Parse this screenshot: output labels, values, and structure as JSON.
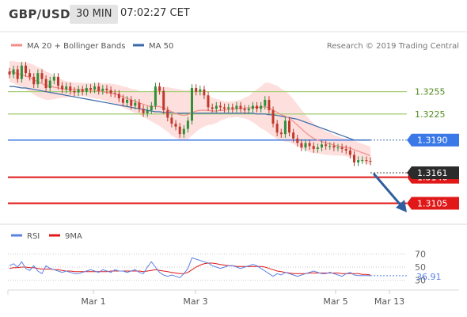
{
  "header": {
    "pair": "GBP/USD",
    "timeframe": "30 MIN",
    "time": "07:02:27 CET"
  },
  "legend": {
    "ma20_bb": "MA 20 + Bollinger Bands",
    "ma50": "MA 50",
    "credit": "Research © 2019 Trading Central"
  },
  "sub_legend": {
    "rsi": "RSI",
    "ma9": "9MA"
  },
  "colors": {
    "bull": "#2f8f3a",
    "bear": "#c0392b",
    "ma20": "#f28e8a",
    "bb_fill": "#fde0de",
    "ma50": "#3a6aa8",
    "resistance": "#a9cf7d",
    "pivot": "#3b78e7",
    "support": "#e01818",
    "rsi": "#5b80e6",
    "rsi_ma": "#e01818",
    "arrow": "#2f5f9e"
  },
  "chart_data": [
    {
      "type": "candlestick",
      "ylim": [
        1.308,
        1.331
      ],
      "current_price": "1.3161",
      "levels": [
        {
          "label": "1.3255",
          "value": 1.3255,
          "kind": "resistance"
        },
        {
          "label": "1.3225",
          "value": 1.3225,
          "kind": "resistance"
        },
        {
          "label": "1.3190",
          "value": 1.319,
          "kind": "pivot"
        },
        {
          "label": "1.3140",
          "value": 1.314,
          "kind": "support"
        },
        {
          "label": "1.3105",
          "value": 1.3105,
          "kind": "support"
        }
      ],
      "x_ticks": [
        "Mar 1",
        "Mar 3",
        "Mar 5",
        "Mar 13"
      ],
      "closes": [
        1.3278,
        1.3285,
        1.3272,
        1.329,
        1.328,
        1.3275,
        1.3265,
        1.328,
        1.3272,
        1.326,
        1.327,
        1.3275,
        1.3263,
        1.3258,
        1.3262,
        1.3256,
        1.3254,
        1.3258,
        1.3255,
        1.326,
        1.3258,
        1.3262,
        1.3256,
        1.3259,
        1.3257,
        1.3253,
        1.3252,
        1.3246,
        1.324,
        1.3244,
        1.3236,
        1.324,
        1.3232,
        1.3226,
        1.323,
        1.3236,
        1.3262,
        1.3256,
        1.323,
        1.322,
        1.3212,
        1.3208,
        1.3198,
        1.3205,
        1.3216,
        1.326,
        1.3255,
        1.3258,
        1.325,
        1.3234,
        1.3232,
        1.3236,
        1.3234,
        1.3232,
        1.3234,
        1.3232,
        1.3236,
        1.3232,
        1.323,
        1.3232,
        1.3236,
        1.3232,
        1.3236,
        1.3244,
        1.323,
        1.3212,
        1.32,
        1.3198,
        1.3216,
        1.32,
        1.3192,
        1.3186,
        1.318,
        1.3186,
        1.3182,
        1.3178,
        1.318,
        1.3184,
        1.3182,
        1.3182,
        1.318,
        1.318,
        1.3178,
        1.3176,
        1.317,
        1.316,
        1.3163,
        1.3163,
        1.3162,
        1.3161
      ],
      "ma20": [
        1.3282,
        1.3281,
        1.3279,
        1.3278,
        1.3276,
        1.3274,
        1.3271,
        1.3268,
        1.3266,
        1.3263,
        1.3262,
        1.3261,
        1.326,
        1.3259,
        1.3258,
        1.3258,
        1.3258,
        1.3258,
        1.3258,
        1.3257,
        1.3257,
        1.3256,
        1.3256,
        1.3255,
        1.3254,
        1.3253,
        1.3252,
        1.325,
        1.3248,
        1.3246,
        1.3244,
        1.3242,
        1.324,
        1.3238,
        1.3236,
        1.3235,
        1.3235,
        1.3235,
        1.3233,
        1.3231,
        1.3228,
        1.3226,
        1.3224,
        1.3223,
        1.3224,
        1.3227,
        1.3229,
        1.323,
        1.323,
        1.323,
        1.3229,
        1.3229,
        1.323,
        1.323,
        1.3231,
        1.3231,
        1.3232,
        1.3232,
        1.3233,
        1.3233,
        1.3234,
        1.3234,
        1.3234,
        1.3235,
        1.3233,
        1.323,
        1.3227,
        1.3224,
        1.3222,
        1.3219,
        1.3215,
        1.321,
        1.3205,
        1.32,
        1.3196,
        1.3192,
        1.319,
        1.3188,
        1.3186,
        1.3185,
        1.3183,
        1.3182,
        1.3181,
        1.318,
        1.3179,
        1.3177,
        1.3175,
        1.3173,
        1.3171,
        1.3169
      ],
      "bb_width": [
        0.0014,
        0.0015,
        0.0016,
        0.0017,
        0.0018,
        0.0019,
        0.002,
        0.002,
        0.002,
        0.0019,
        0.0018,
        0.0016,
        0.0014,
        0.0012,
        0.0011,
        0.001,
        0.0009,
        0.0009,
        0.0009,
        0.0009,
        0.001,
        0.001,
        0.0011,
        0.0011,
        0.0012,
        0.0013,
        0.0013,
        0.0014,
        0.0014,
        0.0015,
        0.0015,
        0.0016,
        0.0016,
        0.0017,
        0.0018,
        0.002,
        0.0023,
        0.0026,
        0.0028,
        0.003,
        0.0032,
        0.0033,
        0.0034,
        0.0034,
        0.0033,
        0.0031,
        0.0028,
        0.0025,
        0.0022,
        0.002,
        0.0018,
        0.0016,
        0.0014,
        0.0012,
        0.0011,
        0.0011,
        0.0011,
        0.0012,
        0.0014,
        0.0016,
        0.002,
        0.0024,
        0.0028,
        0.0032,
        0.0034,
        0.0035,
        0.0036,
        0.0035,
        0.0034,
        0.0032,
        0.003,
        0.0028,
        0.0026,
        0.0024,
        0.0022,
        0.002,
        0.0018,
        0.0017,
        0.0016,
        0.0015,
        0.0014,
        0.0013,
        0.0012,
        0.0012,
        0.0012,
        0.0012,
        0.0012,
        0.0012,
        0.0012,
        0.0012
      ],
      "ma50": [
        1.3262,
        1.3262,
        1.3261,
        1.326,
        1.326,
        1.3259,
        1.3258,
        1.3257,
        1.3256,
        1.3255,
        1.3254,
        1.3253,
        1.3252,
        1.3251,
        1.325,
        1.3249,
        1.3248,
        1.3247,
        1.3246,
        1.3245,
        1.3244,
        1.3243,
        1.3242,
        1.3241,
        1.324,
        1.3239,
        1.3238,
        1.3237,
        1.3236,
        1.3235,
        1.3234,
        1.3233,
        1.3232,
        1.3231,
        1.323,
        1.3229,
        1.3228,
        1.3228,
        1.3227,
        1.3227,
        1.3227,
        1.3226,
        1.3226,
        1.3226,
        1.3226,
        1.3226,
        1.3226,
        1.3226,
        1.3226,
        1.3226,
        1.3226,
        1.3226,
        1.3226,
        1.3226,
        1.3226,
        1.3226,
        1.3226,
        1.3226,
        1.3226,
        1.3226,
        1.3226,
        1.3225,
        1.3225,
        1.3225,
        1.3224,
        1.3224,
        1.3223,
        1.3222,
        1.3221,
        1.322,
        1.3219,
        1.3218,
        1.3216,
        1.3214,
        1.3212,
        1.321,
        1.3208,
        1.3206,
        1.3204,
        1.3202,
        1.32,
        1.3198,
        1.3196,
        1.3194,
        1.3192,
        1.319,
        1.319,
        1.319,
        1.319,
        1.319
      ]
    },
    {
      "type": "line",
      "ylim": [
        20,
        80
      ],
      "y_ticks": [
        "70",
        "50",
        "30"
      ],
      "current_value": "36.91",
      "rsi": [
        52,
        55,
        50,
        58,
        48,
        45,
        52,
        44,
        40,
        52,
        48,
        46,
        44,
        42,
        44,
        42,
        40,
        40,
        42,
        44,
        46,
        44,
        42,
        46,
        44,
        42,
        46,
        44,
        44,
        42,
        44,
        46,
        42,
        40,
        50,
        58,
        50,
        42,
        38,
        36,
        38,
        36,
        34,
        40,
        48,
        64,
        62,
        60,
        58,
        56,
        52,
        50,
        48,
        50,
        52,
        52,
        50,
        48,
        50,
        52,
        54,
        52,
        48,
        44,
        40,
        36,
        40,
        38,
        42,
        40,
        38,
        36,
        38,
        40,
        42,
        44,
        42,
        40,
        40,
        42,
        40,
        38,
        36,
        40,
        42,
        38,
        37,
        37,
        37,
        36.91
      ],
      "ma9": [
        48,
        49,
        49,
        50,
        50,
        49,
        49,
        48,
        47,
        47,
        47,
        46,
        46,
        45,
        44,
        44,
        43,
        43,
        43,
        43,
        43,
        43,
        43,
        43,
        43,
        44,
        44,
        44,
        44,
        44,
        44,
        44,
        44,
        43,
        44,
        45,
        46,
        45,
        44,
        43,
        42,
        41,
        40,
        40,
        42,
        46,
        50,
        53,
        55,
        56,
        56,
        55,
        54,
        53,
        52,
        52,
        51,
        51,
        51,
        51,
        51,
        51,
        51,
        50,
        48,
        46,
        44,
        43,
        42,
        41,
        40,
        40,
        40,
        40,
        41,
        41,
        41,
        41,
        41,
        41,
        41,
        41,
        40,
        40,
        40,
        40,
        40,
        39,
        39,
        38
      ]
    }
  ]
}
